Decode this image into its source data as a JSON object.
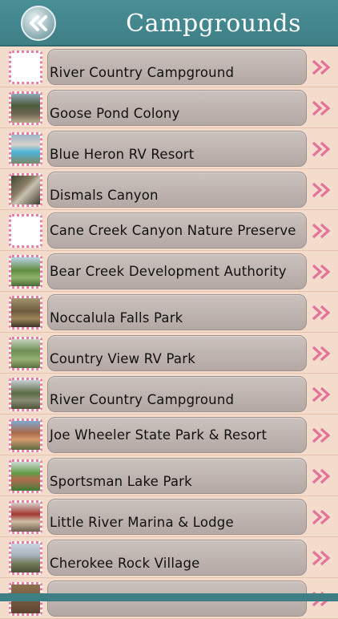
{
  "header": {
    "title": "Campgrounds",
    "back_icon": "double-chevron-left-icon"
  },
  "colors": {
    "header": "#3e7f86",
    "background": "#f4dccd",
    "pill": "#bdb2ad",
    "arrow": "#e3739a",
    "thumb_border": "#e97ba0"
  },
  "items": [
    {
      "label": "River Country Campground",
      "thumb": "blank"
    },
    {
      "label": "Goose Pond Colony",
      "thumb": "forest"
    },
    {
      "label": "Blue Heron RV Resort",
      "thumb": "pool"
    },
    {
      "label": "Dismals Canyon",
      "thumb": "canyon"
    },
    {
      "label": "Cane Creek Canyon Nature Preserve",
      "thumb": "blank"
    },
    {
      "label": "Bear Creek Development Authority",
      "thumb": "lake"
    },
    {
      "label": "Noccalula Falls Park",
      "thumb": "park"
    },
    {
      "label": "Country View RV Park",
      "thumb": "field"
    },
    {
      "label": "River Country Campground",
      "thumb": "trees"
    },
    {
      "label": "Joe Wheeler State Park & Resort",
      "thumb": "resort"
    },
    {
      "label": "Sportsman Lake Park",
      "thumb": "minigolf"
    },
    {
      "label": "Little River Marina & Lodge",
      "thumb": "lodge"
    },
    {
      "label": "Cherokee Rock Village",
      "thumb": "overlook"
    },
    {
      "label": "",
      "thumb": "partial"
    }
  ]
}
